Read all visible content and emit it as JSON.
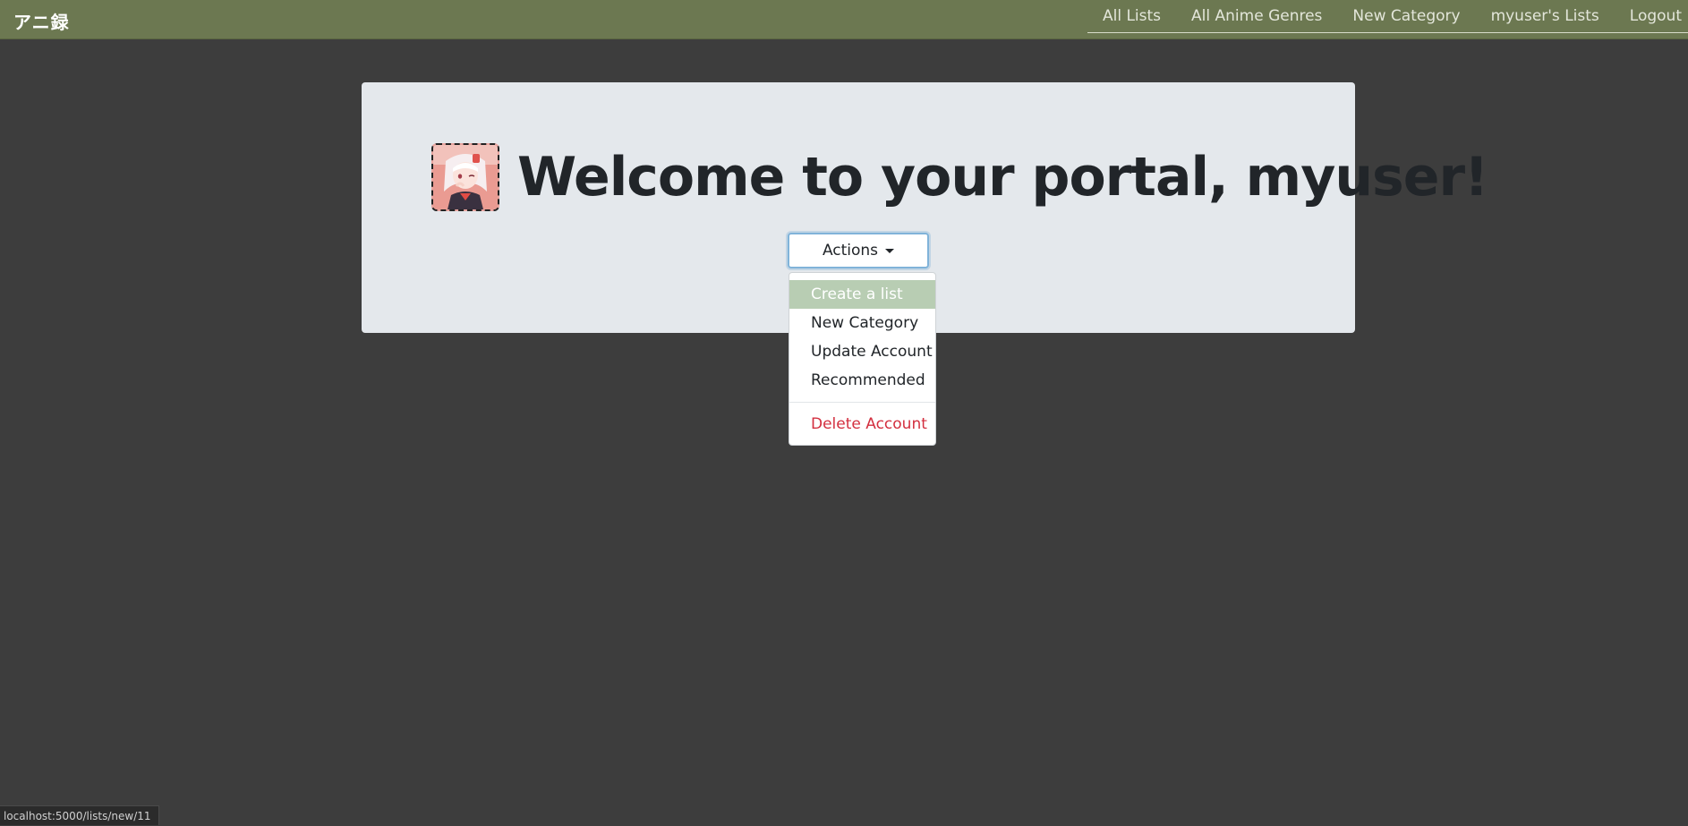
{
  "navbar": {
    "brand": "アニ録",
    "links": [
      "All Lists",
      "All Anime Genres",
      "New Category",
      "myuser's Lists",
      "Logout"
    ]
  },
  "hero": {
    "title": "Welcome to your portal, myuser!",
    "avatar_icon": "anime-avatar-icon"
  },
  "actions": {
    "button_label": "Actions",
    "menu": [
      "Create a list",
      "New Category",
      "Update Account",
      "Recommended"
    ],
    "danger_item": "Delete Account",
    "highlighted_index": 0
  },
  "status_url": "localhost:5000/lists/new/11",
  "colors": {
    "navbar": "#6c7851",
    "page_bg": "#3d3d3d",
    "jumbotron": "#e4e8ec",
    "highlight": "#b8cdb3",
    "danger": "#d32f3f"
  }
}
